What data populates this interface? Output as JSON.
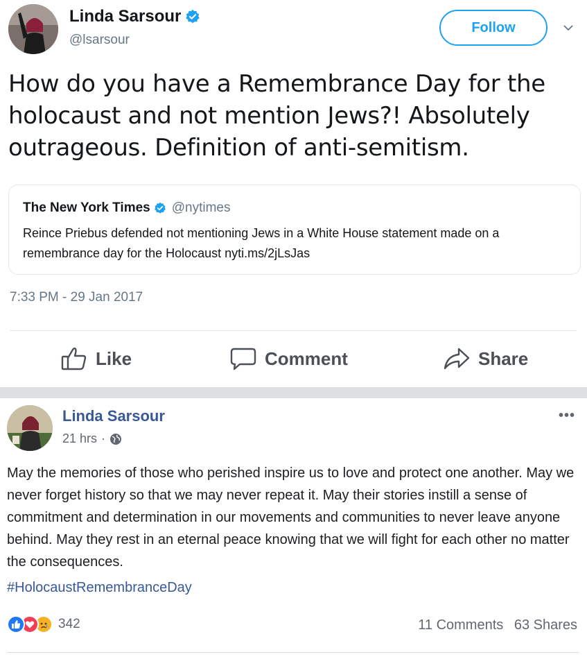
{
  "tweet": {
    "author_name": "Linda Sarsour",
    "author_handle": "@lsarsour",
    "follow_label": "Follow",
    "text": "How do you have a Remembrance Day for the holocaust and not mention Jews?! Absolutely outrageous. Definition of anti-semitism.",
    "quoted": {
      "name": "The New York Times",
      "handle": "@nytimes",
      "text": "Reince Priebus defended not mentioning Jews in a White House statement made on a remembrance day for the Holocaust nyti.ms/2jLsJas"
    },
    "timestamp": "7:33 PM - 29 Jan 2017",
    "colors": {
      "accent": "#1da1f2",
      "muted": "#657786"
    }
  },
  "actions": {
    "like": "Like",
    "comment": "Comment",
    "share": "Share"
  },
  "fb_post": {
    "author_name": "Linda Sarsour",
    "time": "21 hrs",
    "privacy_icon": "globe-icon",
    "text": "May the memories of those who perished inspire us to love and protect one another. May we never forget history so that we may never repeat it. May their stories instill a sense of commitment and determination in our movements and communities to never leave anyone behind. May they rest in an eternal peace knowing that we will fight for each other no matter the consequences.",
    "hashtag": "#HolocaustRemembranceDay",
    "reaction_icons": [
      "like-reaction-icon",
      "love-reaction-icon",
      "sad-reaction-icon"
    ],
    "reaction_count": "342",
    "comments": "11 Comments",
    "shares": "63 Shares",
    "colors": {
      "link": "#385898",
      "text": "#1c1e21"
    }
  }
}
